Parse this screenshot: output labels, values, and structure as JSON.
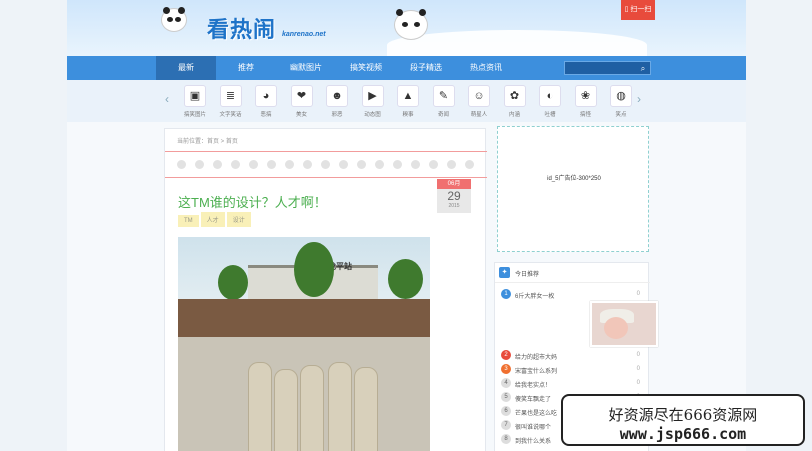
{
  "header": {
    "logo_title": "看热闹",
    "logo_subtitle": "kanrenao.net",
    "scan_label": "扫一扫"
  },
  "nav": {
    "items": [
      "最新",
      "推荐",
      "幽默图片",
      "搞笑视频",
      "段子精选",
      "热点资讯"
    ],
    "active_index": 0,
    "search_placeholder": ""
  },
  "categories": {
    "items": [
      {
        "label": "搞笑图片",
        "icon": "image-icon"
      },
      {
        "label": "文字笑话",
        "icon": "document-icon"
      },
      {
        "label": "恶搞",
        "icon": "panda-icon"
      },
      {
        "label": "美女",
        "icon": "lips-icon"
      },
      {
        "label": "邪恶",
        "icon": "devil-icon"
      },
      {
        "label": "动态图",
        "icon": "gif-icon"
      },
      {
        "label": "糗事",
        "icon": "poop-icon"
      },
      {
        "label": "奇闻",
        "icon": "pencil-icon"
      },
      {
        "label": "萌星人",
        "icon": "cat-icon"
      },
      {
        "label": "内涵",
        "icon": "flower-icon"
      },
      {
        "label": "吐槽",
        "icon": "melon-icon"
      },
      {
        "label": "搞怪",
        "icon": "pig-icon"
      },
      {
        "label": "笑点",
        "icon": "color-wheel-icon"
      }
    ]
  },
  "post": {
    "breadcrumb": "当前位置：首页 > 首页",
    "title": "这TM谁的设计？人才啊！",
    "date_month": "06月",
    "date_day": "29",
    "date_year": "2015",
    "tags": [
      "TM",
      "人才",
      "设计"
    ],
    "photo_sign": "龙平站"
  },
  "sidebar": {
    "ad_text": "id_5广告位-300*250",
    "today_title": "今日推荐",
    "ranks": [
      {
        "num": "1",
        "text": "6斤大胖女一枚",
        "count": "0"
      },
      {
        "num": "2",
        "text": "给力的超市大妈",
        "count": "0"
      },
      {
        "num": "3",
        "text": "宋富宝什么系列",
        "count": "0"
      },
      {
        "num": "4",
        "text": "给我老实点！",
        "count": "0"
      },
      {
        "num": "5",
        "text": "傻笑车飘走了",
        "count": "0"
      },
      {
        "num": "6",
        "text": "芒果也是这么吃",
        "count": "0"
      },
      {
        "num": "7",
        "text": "很叫谁说哪个",
        "count": "0"
      },
      {
        "num": "8",
        "text": "到我什么关系",
        "count": "0"
      }
    ]
  },
  "watermark": {
    "line1": "好资源尽在666资源网",
    "line2": "www.jsp666.com"
  },
  "colors": {
    "nav_bg": "#3d8fdd",
    "title_green": "#4caf50",
    "accent_red": "#e84b3c"
  }
}
